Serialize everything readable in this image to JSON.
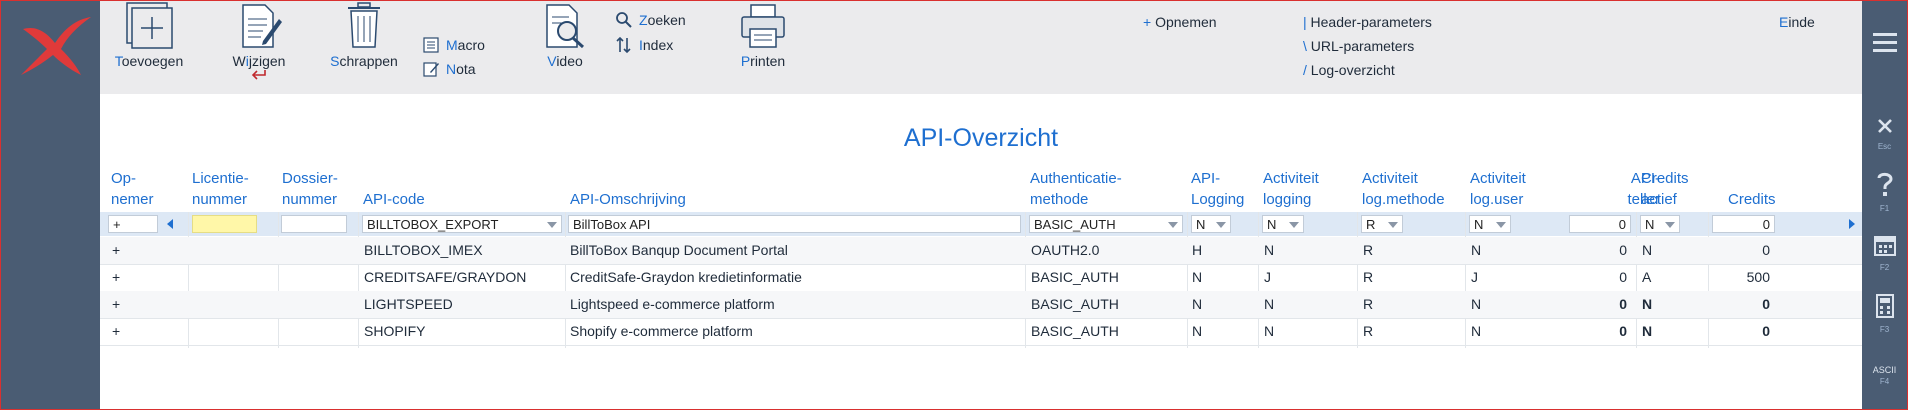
{
  "toolbar": {
    "add": {
      "accent": "T",
      "rest": "oevoegen"
    },
    "edit": {
      "pre": "W",
      "accent": "i",
      "rest": "jzigen"
    },
    "delete": {
      "accent": "S",
      "rest": "chrappen"
    },
    "macro": {
      "accent": "M",
      "rest": "acro"
    },
    "note": {
      "accent": "N",
      "rest": "ota"
    },
    "video": {
      "accent": "V",
      "rest": "ideo"
    },
    "search": {
      "accent": "Z",
      "rest": "oeken"
    },
    "index": {
      "accent": "I",
      "rest": "ndex"
    },
    "print": {
      "accent": "P",
      "rest": "rinten"
    },
    "record": {
      "accent": "+",
      "rest": " Opnemen"
    },
    "header_params": {
      "accent": "|",
      "rest": " Header-parameters"
    },
    "url_params": {
      "accent": "\\",
      "rest": " URL-parameters"
    },
    "log_overview": {
      "accent": "/",
      "rest": " Log-overzicht"
    },
    "end": {
      "accent": "E",
      "rest": "inde"
    }
  },
  "page_title": "API-Overzicht",
  "columns": {
    "opnemen": [
      "Op-",
      "nemer"
    ],
    "licentie": [
      "Licentie-",
      "nummer"
    ],
    "dossier": [
      "Dossier-",
      "nummer"
    ],
    "api_code": "API-code",
    "api_omschrijving": "API-Omschrijving",
    "auth": [
      "Authenticatie-",
      "methode"
    ],
    "api_logging": [
      "API-",
      "Logging"
    ],
    "act_logging": [
      "Activiteit",
      "logging"
    ],
    "act_method": [
      "Activiteit",
      "log.methode"
    ],
    "act_user": [
      "Activiteit",
      "log.user"
    ],
    "api_teller": [
      "API-",
      "teller"
    ],
    "credits_actief": [
      "Credits",
      "actief"
    ],
    "credits": "Credits"
  },
  "filter": {
    "opnemen": "+",
    "licentie": "",
    "dossier": "",
    "api_code": "BILLTOBOX_EXPORT",
    "api_omschrijving": "BillToBox API",
    "auth": "BASIC_AUTH",
    "api_logging": "N",
    "act_logging": "N",
    "act_method": "R",
    "act_user": "N",
    "api_teller": "0",
    "credits_actief": "N",
    "credits": "0"
  },
  "rows": [
    {
      "opnemen": "+",
      "api_code": "BILLTOBOX_IMEX",
      "api_omschrijving": "BillToBox Banqup Document Portal",
      "auth": "OAUTH2.0",
      "api_logging": "H",
      "act_logging": "N",
      "act_method": "R",
      "act_user": "N",
      "api_teller": "0",
      "credits_actief": "N",
      "credits": "0"
    },
    {
      "opnemen": "+",
      "api_code": "CREDITSAFE/GRAYDON",
      "api_omschrijving": "CreditSafe-Graydon kredietinformatie",
      "auth": "BASIC_AUTH",
      "api_logging": "N",
      "act_logging": "J",
      "act_method": "R",
      "act_user": "J",
      "api_teller": "0",
      "credits_actief": "A",
      "credits": "500"
    },
    {
      "opnemen": "+",
      "api_code": "LIGHTSPEED",
      "api_omschrijving": "Lightspeed e-commerce platform",
      "auth": "BASIC_AUTH",
      "api_logging": "N",
      "act_logging": "N",
      "act_method": "R",
      "act_user": "N",
      "api_teller": "0",
      "credits_actief": "N",
      "credits": "0"
    },
    {
      "opnemen": "+",
      "api_code": "SHOPIFY",
      "api_omschrijving": "Shopify e-commerce platform",
      "auth": "BASIC_AUTH",
      "api_logging": "N",
      "act_logging": "N",
      "act_method": "R",
      "act_user": "N",
      "api_teller": "0",
      "credits_actief": "N",
      "credits": "0"
    }
  ],
  "right_bar": {
    "close_key": "Esc",
    "help_key": "F1",
    "calendar_key": "F2",
    "calculator_key": "F3",
    "ascii_label": "ASCII",
    "ascii_key": "F4"
  },
  "colors": {
    "accent": "#1e6fd0",
    "sidebar": "#4a5c73",
    "toolbar": "#ebebed",
    "logo": "#e03a3a"
  }
}
